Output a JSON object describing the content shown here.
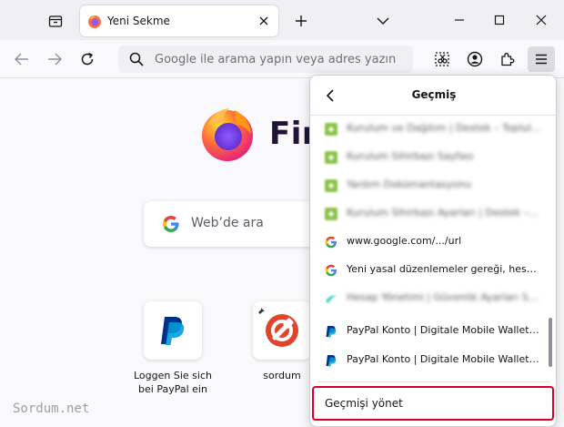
{
  "tab": {
    "title": "Yeni Sekme"
  },
  "urlbar": {
    "placeholder": "Google ile arama yapın veya adres yazın"
  },
  "newtab": {
    "brand": "Fire",
    "search_placeholder": "Web’de ara",
    "shortcuts": [
      {
        "label": "Loggen Sie sich bei PayPal ein",
        "icon": "paypal-icon"
      },
      {
        "label": "sordum",
        "icon": "sordum-icon"
      }
    ]
  },
  "watermark": "Sordum.net",
  "history_panel": {
    "title": "Geçmiş",
    "items": [
      {
        "label": "Kurulum ve Dağıtım | Destek – Topluluk",
        "icon": "green-tile-icon",
        "blurred": true
      },
      {
        "label": "Kurulum Sihirbazı Sayfası",
        "icon": "green-tile-icon",
        "blurred": true
      },
      {
        "label": "Yardım Dokümantasyonu",
        "icon": "green-tile-icon",
        "blurred": true
      },
      {
        "label": "Kurulum Sihirbazı Ayarları | Destek – Topluluk",
        "icon": "green-tile-icon",
        "blurred": true
      },
      {
        "label": "www.google.com/.../url",
        "icon": "google-icon",
        "blurred": false
      },
      {
        "label": "Yeni yasal düzenlemeler gereği, hesabınız hakkında",
        "icon": "google-icon",
        "blurred": false
      },
      {
        "label": "Hesap Yönetimi | Güvenlik Ayarları Sayfası",
        "icon": "cyan-swoosh-icon",
        "blurred": true
      },
      {
        "label": "PayPal Konto | Digitale Mobile Wallet | PayPal DE",
        "icon": "paypal-icon",
        "blurred": false
      },
      {
        "label": "PayPal Konto | Digitale Mobile Wallet | PayPal DE",
        "icon": "paypal-icon",
        "blurred": false
      }
    ],
    "manage_label": "Geçmişi yönet"
  },
  "colors": {
    "accent_red": "#d70022",
    "paypal_dark": "#003087",
    "paypal_light": "#009cde",
    "firefox_orange": "#ff7139",
    "firefox_purple": "#9059ff"
  }
}
